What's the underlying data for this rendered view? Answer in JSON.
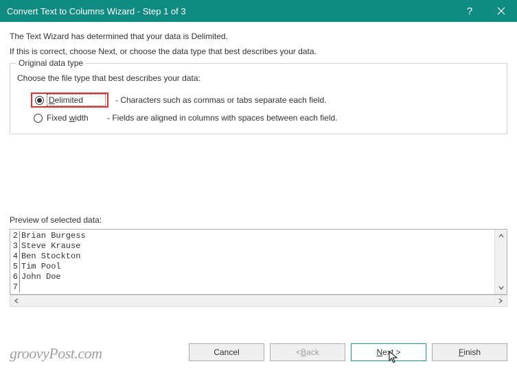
{
  "titlebar": {
    "title": "Convert Text to Columns Wizard - Step 1 of 3"
  },
  "intro1": "The Text Wizard has determined that your data is Delimited.",
  "intro2": "If this is correct, choose Next, or choose the data type that best describes your data.",
  "fieldset": {
    "legend": "Original data type",
    "prompt": "Choose the file type that best describes your data:",
    "radios": [
      {
        "label_pre": "",
        "label_u": "D",
        "label_post": "elimited",
        "desc": "- Characters such as commas or tabs separate each field.",
        "checked": true
      },
      {
        "label_pre": "Fixed ",
        "label_u": "w",
        "label_post": "idth",
        "desc": "- Fields are aligned in columns with spaces between each field.",
        "checked": false
      }
    ]
  },
  "preview": {
    "label": "Preview of selected data:",
    "rows": [
      {
        "n": "2",
        "v": "Brian Burgess"
      },
      {
        "n": "3",
        "v": "Steve Krause"
      },
      {
        "n": "4",
        "v": "Ben Stockton"
      },
      {
        "n": "5",
        "v": "Tim Pool"
      },
      {
        "n": "6",
        "v": "John Doe"
      },
      {
        "n": "7",
        "v": ""
      }
    ]
  },
  "buttons": {
    "cancel": "Cancel",
    "back_lt": "< ",
    "back_u": "B",
    "back_post": "ack",
    "next_u": "N",
    "next_post": "ext >",
    "finish_u": "F",
    "finish_post": "inish"
  },
  "watermark": "groovyPost.com"
}
